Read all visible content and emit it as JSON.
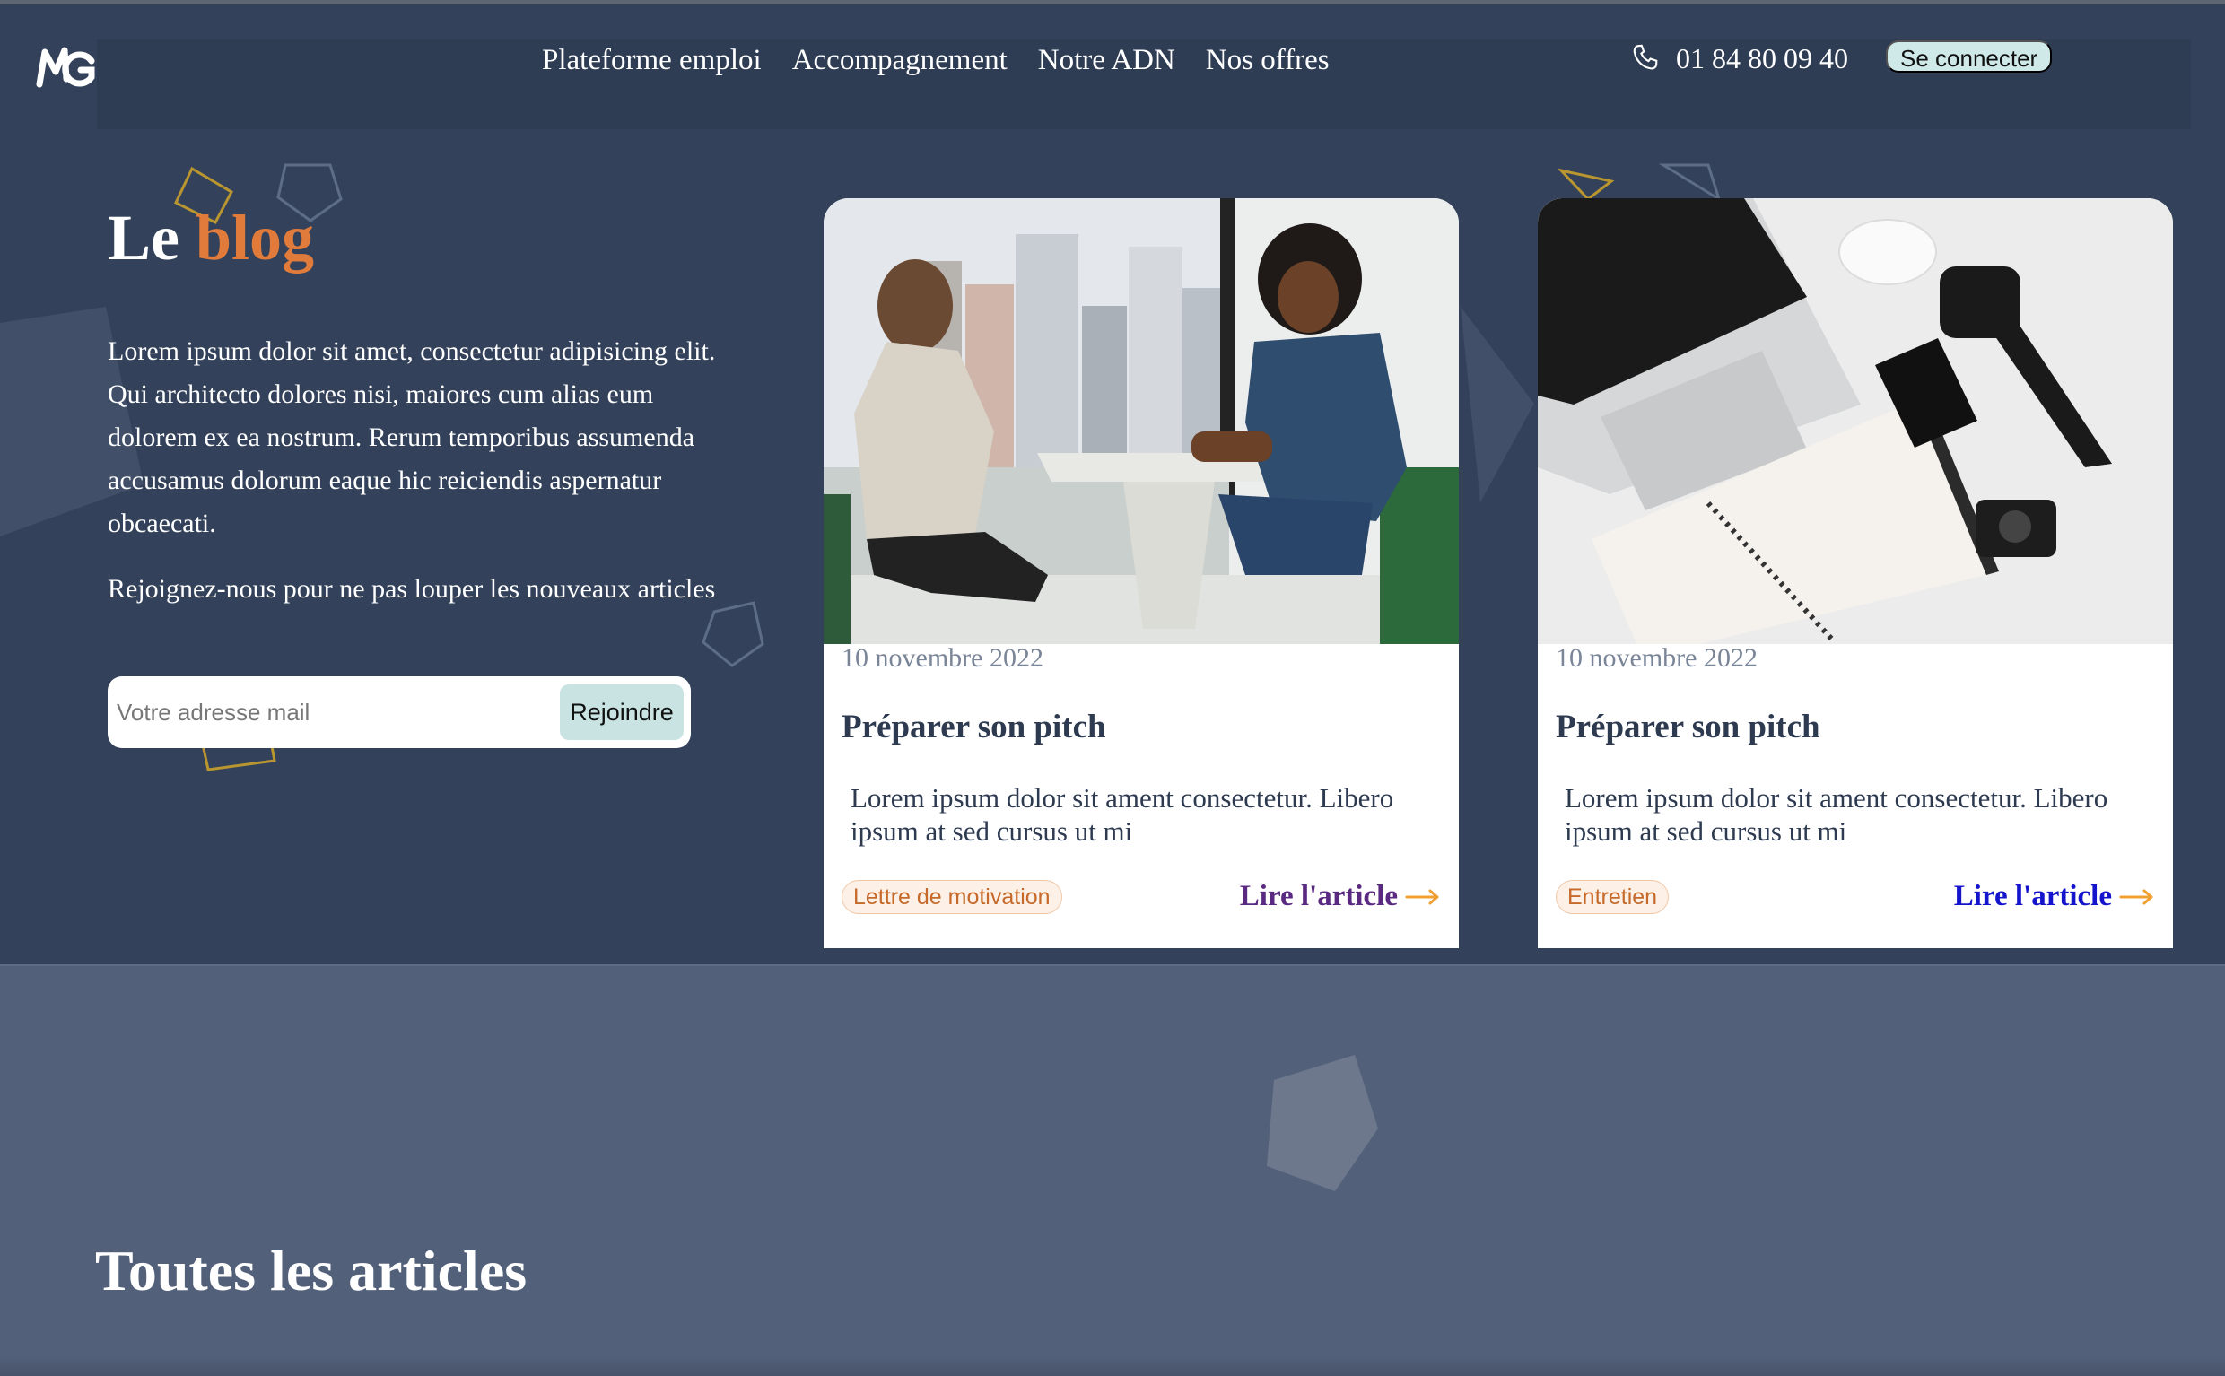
{
  "header": {
    "logo_text": "MG",
    "nav": [
      "Plateforme emploi",
      "Accompagnement",
      "Notre ADN",
      "Nos offres"
    ],
    "phone": "01 84 80 09 40",
    "connect_label": "Se connecter"
  },
  "hero": {
    "title_prefix": "Le",
    "title_accent": "blog",
    "description": "Lorem ipsum dolor sit amet, consectetur adipisicing elit. Qui architecto dolores nisi, maiores cum alias eum dolorem ex ea nostrum. Rerum temporibus assumenda accusamus dolorum eaque hic reiciendis aspernatur obcaecati.",
    "subscribe_text": "Rejoignez-nous pour ne pas louper les nouveaux articles",
    "email_placeholder": "Votre adresse mail",
    "join_label": "Rejoindre"
  },
  "cards": [
    {
      "date": "10 novembre 2022",
      "title": "Préparer son pitch",
      "excerpt": "Lorem ipsum dolor sit ament consectetur. Libero ipsum at sed cursus ut mi",
      "tag": "Lettre de motivation",
      "link": "Lire l'article",
      "image": "two-women-meeting-photo"
    },
    {
      "date": "10 novembre 2022",
      "title": "Préparer son pitch",
      "excerpt": "Lorem ipsum dolor sit ament consectetur. Libero ipsum at sed cursus ut mi",
      "tag": "Entretien",
      "link": "Lire l'article",
      "image": "laptop-desk-flatlay-photo"
    }
  ],
  "section_title": "Toutes les articles",
  "colors": {
    "hero_bg": "#33425a",
    "lower_bg": "#53607a",
    "accent": "#e07b3b",
    "connect_bg": "#cfe8e8",
    "link_arrow": "#f0a030"
  }
}
